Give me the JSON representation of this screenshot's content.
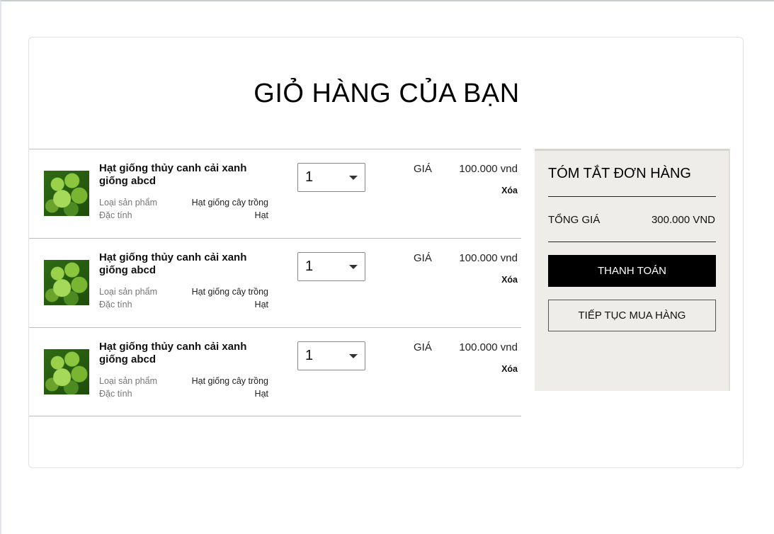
{
  "page": {
    "title": "GIỎ HÀNG CỦA BẠN"
  },
  "cart": {
    "items": [
      {
        "name": "Hạt giống thủy canh cải xanh giống abcd",
        "type_label": "Loại sản phẩm",
        "type_value": "Hạt giống cây trồng",
        "feature_label": "Đặc tính",
        "feature_value": "Hạt",
        "quantity": "1",
        "price_label": "GIÁ",
        "price": "100.000 vnd",
        "remove_label": "Xóa",
        "image_icon": "broccoli-image"
      },
      {
        "name": "Hạt giống thủy canh cải xanh giống abcd",
        "type_label": "Loại sản phẩm",
        "type_value": "Hạt giống cây trồng",
        "feature_label": "Đặc tính",
        "feature_value": "Hạt",
        "quantity": "1",
        "price_label": "GIÁ",
        "price": "100.000 vnd",
        "remove_label": "Xóa",
        "image_icon": "broccoli-image"
      },
      {
        "name": "Hạt giống thủy canh cải xanh giống abcd",
        "type_label": "Loại sản phẩm",
        "type_value": "Hạt giống cây trồng",
        "feature_label": "Đặc tính",
        "feature_value": "Hạt",
        "quantity": "1",
        "price_label": "GIÁ",
        "price": "100.000 vnd",
        "remove_label": "Xóa",
        "image_icon": "broccoli-image"
      }
    ]
  },
  "summary": {
    "title": "TÓM TẮT ĐƠN HÀNG",
    "total_label": "TỔNG GIÁ",
    "total_value": "300.000 VND",
    "checkout_label": "THANH TOÁN",
    "continue_label": "TIẾP TỤC MUA HÀNG"
  },
  "colors": {
    "summary_bg": "#efede9",
    "checkout_bg": "#000000",
    "checkout_text": "#ffffff"
  }
}
